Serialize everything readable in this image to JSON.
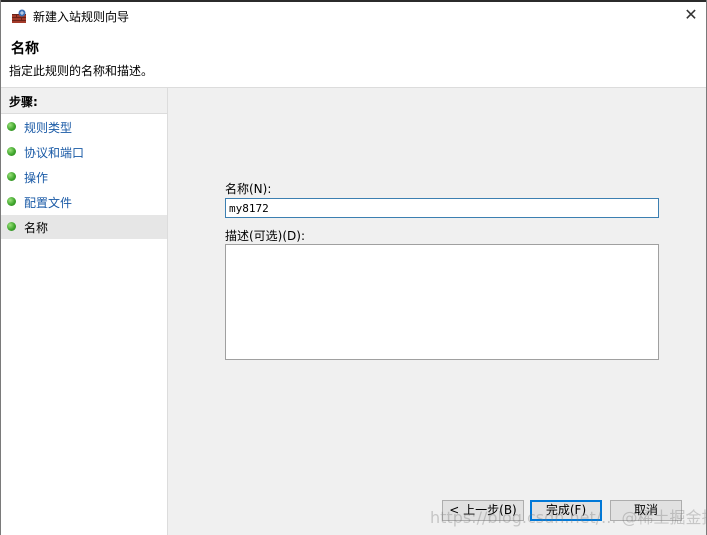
{
  "window": {
    "title": "新建入站规则向导",
    "close_symbol": "✕"
  },
  "header": {
    "title": "名称",
    "description": "指定此规则的名称和描述。"
  },
  "sidebar": {
    "steps_title": "步骤:",
    "items": [
      {
        "label": "规则类型"
      },
      {
        "label": "协议和端口"
      },
      {
        "label": "操作"
      },
      {
        "label": "配置文件"
      },
      {
        "label": "名称"
      }
    ]
  },
  "form": {
    "name_label": "名称(N):",
    "name_value": "my8172",
    "description_label": "描述(可选)(D):",
    "description_value": ""
  },
  "buttons": {
    "back": "< 上一步(B)",
    "finish": "完成(F)",
    "cancel": "取消"
  },
  "watermark": "https://blog.csdn.net/...  @稀土掘金技术社区",
  "colors": {
    "link": "#1a5aa6",
    "step_dot": "#3fa62d",
    "input_focus_border": "#3c7fb1",
    "primary_border": "#0078d7"
  }
}
